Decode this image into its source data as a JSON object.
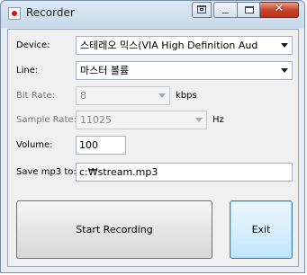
{
  "window": {
    "title": "Recorder"
  },
  "icons": {
    "app": "red-dot-record-icon",
    "restore": "restore-icon",
    "minimize": "minimize-icon",
    "maximize": "maximize-icon",
    "close": "close-icon",
    "close_glyph": "✕"
  },
  "form": {
    "device": {
      "label": "Device:",
      "value": "스테레오 믹스(VIA High Definition Aud"
    },
    "line": {
      "label": "Line:",
      "value": "마스터 볼륨"
    },
    "bit_rate": {
      "label": "Bit Rate:",
      "value": "8",
      "unit": "kbps"
    },
    "sample_rate": {
      "label": "Sample Rate:",
      "value": "11025",
      "unit": "Hz"
    },
    "volume": {
      "label": "Volume:",
      "value": "100"
    },
    "save_path": {
      "label": "Save mp3 to:",
      "value": "c:₩stream.mp3"
    }
  },
  "buttons": {
    "start": "Start Recording",
    "exit": "Exit"
  },
  "colors": {
    "close_button": "#c8442a",
    "record_dot": "#e01010",
    "focus_border": "#3c7fb1"
  }
}
